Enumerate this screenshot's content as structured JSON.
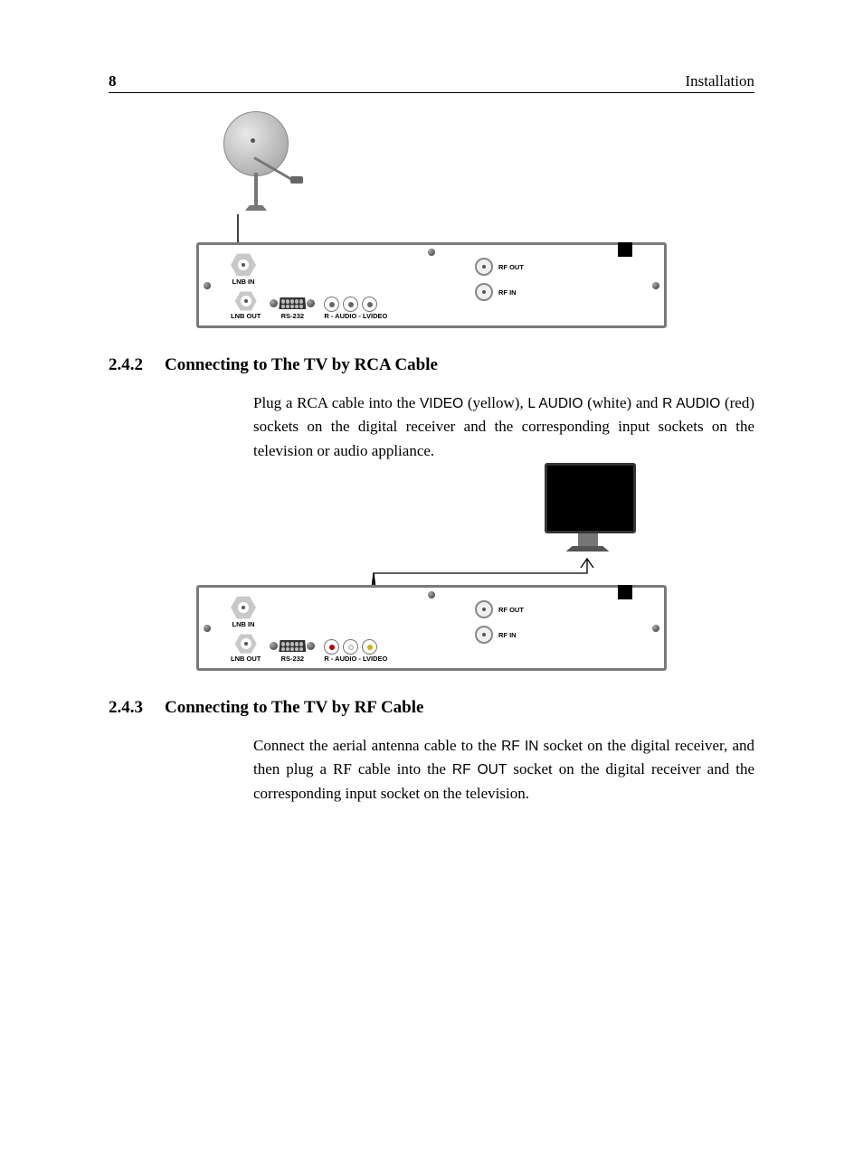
{
  "page_number": "8",
  "chapter_title": "Installation",
  "panel_labels": {
    "lnb_in": "LNB IN",
    "lnb_out": "LNB OUT",
    "rs232": "RS-232",
    "audio_video": "R - AUDIO - LVIDEO",
    "rf_out": "RF OUT",
    "rf_in": "RF IN"
  },
  "section_242": {
    "number": "2.4.2",
    "title": "Connecting to The TV by RCA Cable",
    "body_parts": [
      "Plug a RCA cable into the ",
      "VIDEO",
      " (yellow), ",
      "L AUDIO",
      " (white) and ",
      "R AUDIO",
      " (red) sockets on the digital receiver and the corresponding input sockets on the television or audio appliance."
    ]
  },
  "section_243": {
    "number": "2.4.3",
    "title": "Connecting to The TV by RF Cable",
    "body_parts": [
      "Connect the aerial antenna cable to the ",
      "RF IN",
      " socket on the digital receiver, and then plug a RF cable into the ",
      "RF OUT",
      " socket on the digital receiver and the corresponding input socket on the television."
    ]
  }
}
